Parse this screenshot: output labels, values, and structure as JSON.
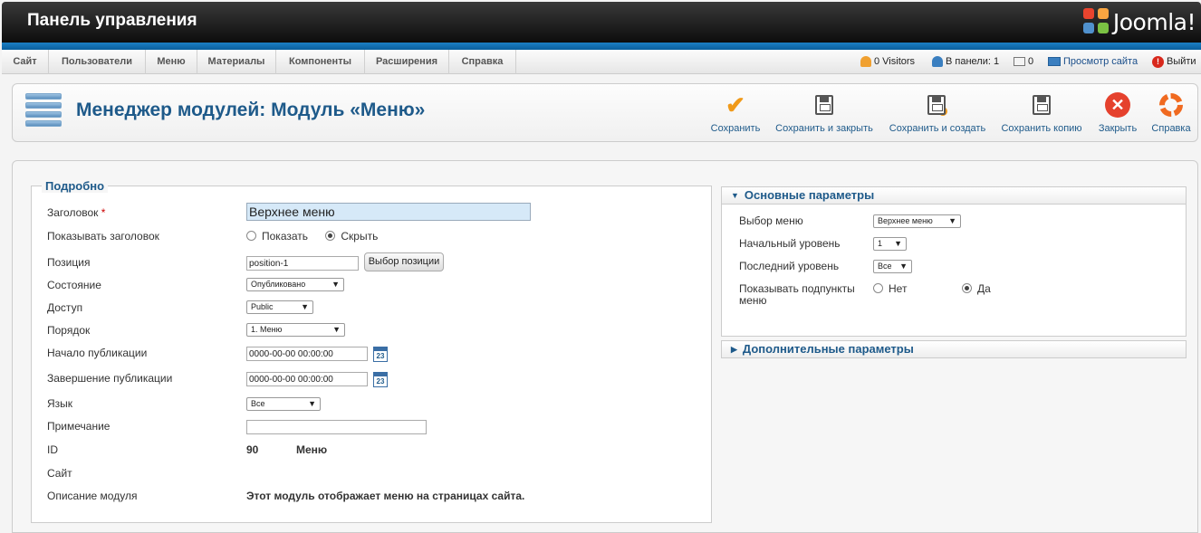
{
  "header": {
    "title": "Панель управления",
    "logo_text": "Joomla!"
  },
  "menu": [
    {
      "label": "Сайт"
    },
    {
      "label": "Пользователи"
    },
    {
      "label": "Меню"
    },
    {
      "label": "Материалы"
    },
    {
      "label": "Компоненты"
    },
    {
      "label": "Расширения"
    },
    {
      "label": "Справка"
    }
  ],
  "status": {
    "visitors": "0 Visitors",
    "admins": "В панели: 1",
    "messages": "0",
    "view_site": "Просмотр сайта",
    "logout": "Выйти"
  },
  "toolbar": {
    "title": "Менеджер модулей: Модуль «Меню»",
    "buttons": {
      "save": "Сохранить",
      "save_close": "Сохранить и закрыть",
      "save_new": "Сохранить и создать",
      "save_copy": "Сохранить копию",
      "close": "Закрыть",
      "help": "Справка"
    }
  },
  "details": {
    "legend": "Подробно",
    "title_label": "Заголовок",
    "title_required": "*",
    "title_value": "Верхнее меню",
    "show_title_label": "Показывать заголовок",
    "show_title_options": [
      "Показать",
      "Скрыть"
    ],
    "show_title_selected": "Скрыть",
    "position_label": "Позиция",
    "position_value": "position-1",
    "position_button": "Выбор позиции",
    "state_label": "Состояние",
    "state_value": "Опубликовано",
    "access_label": "Доступ",
    "access_value": "Public",
    "order_label": "Порядок",
    "order_value": "1. Меню",
    "publish_up_label": "Начало публикации",
    "publish_up_value": "0000-00-00 00:00:00",
    "publish_down_label": "Завершение публикации",
    "publish_down_value": "0000-00-00 00:00:00",
    "calendar_day": "23",
    "language_label": "Язык",
    "language_value": "Все",
    "note_label": "Примечание",
    "note_value": "",
    "id_label": "ID",
    "id_value": "90",
    "module_type": "Меню",
    "site_label": "Сайт",
    "description_label": "Описание модуля",
    "description_value": "Этот модуль отображает меню на страницах сайта."
  },
  "basic_params": {
    "title": "Основные параметры",
    "menu_label": "Выбор меню",
    "menu_value": "Верхнее меню",
    "start_level_label": "Начальный уровень",
    "start_level_value": "1",
    "end_level_label": "Последний уровень",
    "end_level_value": "Все",
    "show_sub_label": "Показывать подпункты меню",
    "show_sub_options": [
      "Нет",
      "Да"
    ],
    "show_sub_selected": "Да"
  },
  "advanced_params": {
    "title": "Дополнительные параметры"
  },
  "colors": {
    "accent": "#1e5a8a",
    "header_bg": "#1a1a1a",
    "blue_bar": "#1b7fc4"
  }
}
